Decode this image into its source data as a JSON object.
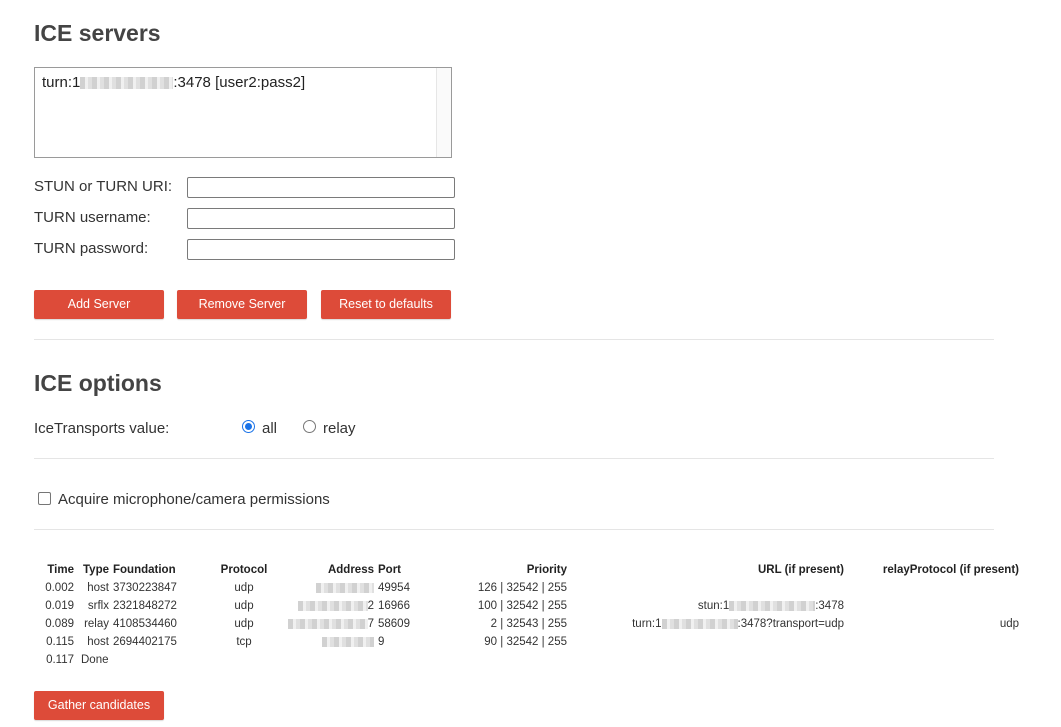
{
  "ice_servers": {
    "title": "ICE servers",
    "list": [
      {
        "prefix": "turn:1",
        "suffix": ":3478 [user2:pass2]"
      }
    ],
    "fields": {
      "uri_label": "STUN or TURN URI:",
      "uri_value": "",
      "username_label": "TURN username:",
      "username_value": "",
      "password_label": "TURN password:",
      "password_value": ""
    },
    "buttons": {
      "add": "Add Server",
      "remove": "Remove Server",
      "reset": "Reset to defaults"
    }
  },
  "ice_options": {
    "title": "ICE options",
    "transports_label": "IceTransports value:",
    "option_all": "all",
    "option_relay": "relay",
    "selected": "all",
    "acquire_label": "Acquire microphone/camera permissions",
    "acquire_checked": false
  },
  "candidates": {
    "headers": {
      "time": "Time",
      "type": "Type",
      "foundation": "Foundation",
      "protocol": "Protocol",
      "address": "Address",
      "port": "Port",
      "priority": "Priority",
      "url": "URL (if present)",
      "relay_protocol": "relayProtocol (if present)"
    },
    "rows": [
      {
        "time": "0.002",
        "type": "host",
        "foundation": "3730223847",
        "protocol": "udp",
        "address_tail": "",
        "port": "49954",
        "priority": "126 | 32542 | 255",
        "url": "",
        "relay_protocol": ""
      },
      {
        "time": "0.019",
        "type": "srflx",
        "foundation": "2321848272",
        "protocol": "udp",
        "address_tail": "2",
        "port": "16966",
        "priority": "100 | 32542 | 255",
        "url": "stun:1",
        "url_tail": ":3478",
        "relay_protocol": ""
      },
      {
        "time": "0.089",
        "type": "relay",
        "foundation": "4108534460",
        "protocol": "udp",
        "address_tail": "7",
        "port": "58609",
        "priority": "2 | 32543 | 255",
        "url": "turn:1",
        "url_tail": ":3478?transport=udp",
        "relay_protocol": "udp"
      },
      {
        "time": "0.115",
        "type": "host",
        "foundation": "2694402175",
        "protocol": "tcp",
        "address_tail": "",
        "port": "9",
        "priority": "90 | 32542 | 255",
        "url": "",
        "relay_protocol": ""
      }
    ],
    "done_row": {
      "time": "0.117",
      "text": "Done"
    }
  },
  "gather_button": "Gather candidates",
  "colors": {
    "button_bg": "#dd4b39",
    "button_text": "#ffffff",
    "radio_accent": "#1a73e8",
    "heading": "#444444"
  }
}
